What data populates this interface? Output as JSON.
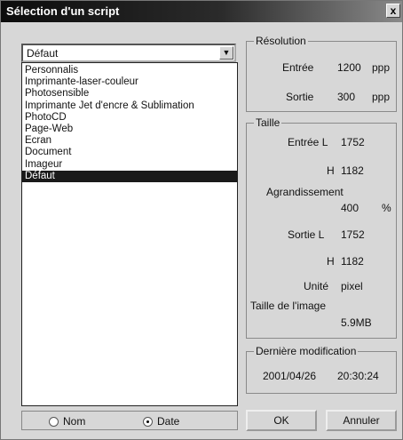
{
  "window": {
    "title": "Sélection d'un script",
    "close_glyph": "x"
  },
  "script_select": {
    "value": "Défaut"
  },
  "script_list": [
    {
      "label": "Personnalis",
      "selected": false
    },
    {
      "label": "Imprimante-laser-couleur",
      "selected": false
    },
    {
      "label": "Photosensible",
      "selected": false
    },
    {
      "label": "Imprimante Jet d'encre & Sublimation",
      "selected": false
    },
    {
      "label": "PhotoCD",
      "selected": false
    },
    {
      "label": "Page-Web",
      "selected": false
    },
    {
      "label": "Ecran",
      "selected": false
    },
    {
      "label": "Document",
      "selected": false
    },
    {
      "label": "Imageur",
      "selected": false
    },
    {
      "label": "Défaut",
      "selected": true
    }
  ],
  "sort": {
    "name_label": "Nom",
    "date_label": "Date",
    "selected": "date"
  },
  "resolution": {
    "legend": "Résolution",
    "input_label": "Entrée",
    "input_value": "1200",
    "input_unit": "ppp",
    "output_label": "Sortie",
    "output_value": "300",
    "output_unit": "ppp"
  },
  "size": {
    "legend": "Taille",
    "input_l_label": "Entrée L",
    "input_l_value": "1752",
    "input_h_label": "H",
    "input_h_value": "1182",
    "enlarge_label": "Agrandissement",
    "enlarge_value": "400",
    "enlarge_unit": "%",
    "output_l_label": "Sortie L",
    "output_l_value": "1752",
    "output_h_label": "H",
    "output_h_value": "1182",
    "unit_label": "Unité",
    "unit_value": "pixel",
    "image_size_label": "Taille de l'image",
    "image_size_value": "5.9MB"
  },
  "last_modified": {
    "legend": "Dernière modification",
    "date": "2001/04/26",
    "time": "20:30:24"
  },
  "buttons": {
    "ok": "OK",
    "cancel": "Annuler"
  }
}
